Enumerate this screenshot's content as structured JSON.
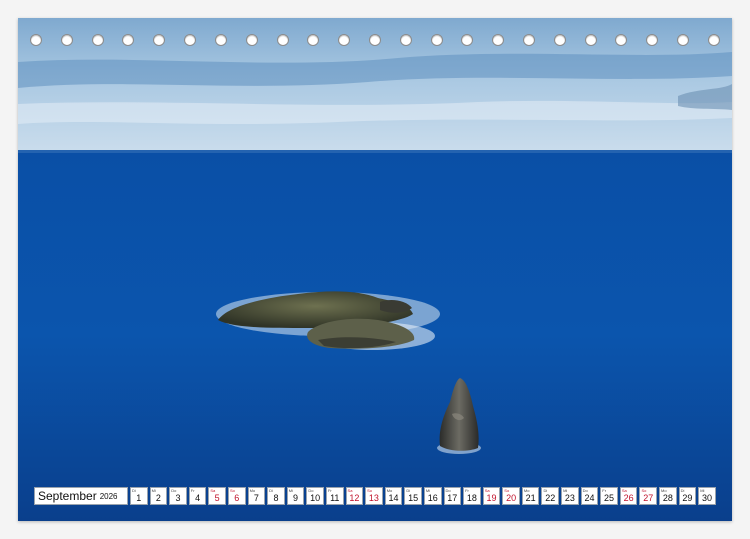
{
  "calendar": {
    "month": "September",
    "year": "2026",
    "days": [
      {
        "num": "1",
        "abbr": "Di",
        "weekend": false
      },
      {
        "num": "2",
        "abbr": "Mi",
        "weekend": false
      },
      {
        "num": "3",
        "abbr": "Do",
        "weekend": false
      },
      {
        "num": "4",
        "abbr": "Fr",
        "weekend": false
      },
      {
        "num": "5",
        "abbr": "Sa",
        "weekend": true
      },
      {
        "num": "6",
        "abbr": "So",
        "weekend": true
      },
      {
        "num": "7",
        "abbr": "Mo",
        "weekend": false
      },
      {
        "num": "8",
        "abbr": "Di",
        "weekend": false
      },
      {
        "num": "9",
        "abbr": "Mi",
        "weekend": false
      },
      {
        "num": "10",
        "abbr": "Do",
        "weekend": false
      },
      {
        "num": "11",
        "abbr": "Fr",
        "weekend": false
      },
      {
        "num": "12",
        "abbr": "Sa",
        "weekend": true
      },
      {
        "num": "13",
        "abbr": "So",
        "weekend": true
      },
      {
        "num": "14",
        "abbr": "Mo",
        "weekend": false
      },
      {
        "num": "15",
        "abbr": "Di",
        "weekend": false
      },
      {
        "num": "16",
        "abbr": "Mi",
        "weekend": false
      },
      {
        "num": "17",
        "abbr": "Do",
        "weekend": false
      },
      {
        "num": "18",
        "abbr": "Fr",
        "weekend": false
      },
      {
        "num": "19",
        "abbr": "Sa",
        "weekend": true
      },
      {
        "num": "20",
        "abbr": "So",
        "weekend": true
      },
      {
        "num": "21",
        "abbr": "Mo",
        "weekend": false
      },
      {
        "num": "22",
        "abbr": "Di",
        "weekend": false
      },
      {
        "num": "23",
        "abbr": "Mi",
        "weekend": false
      },
      {
        "num": "24",
        "abbr": "Do",
        "weekend": false
      },
      {
        "num": "25",
        "abbr": "Fr",
        "weekend": false
      },
      {
        "num": "26",
        "abbr": "Sa",
        "weekend": true
      },
      {
        "num": "27",
        "abbr": "So",
        "weekend": true
      },
      {
        "num": "28",
        "abbr": "Mo",
        "weekend": false
      },
      {
        "num": "29",
        "abbr": "Di",
        "weekend": false
      },
      {
        "num": "30",
        "abbr": "Mi",
        "weekend": false
      }
    ]
  },
  "colors": {
    "sky": "#8fb8d8",
    "ocean": "#0b4ea3",
    "weekend": "#c0122b"
  }
}
